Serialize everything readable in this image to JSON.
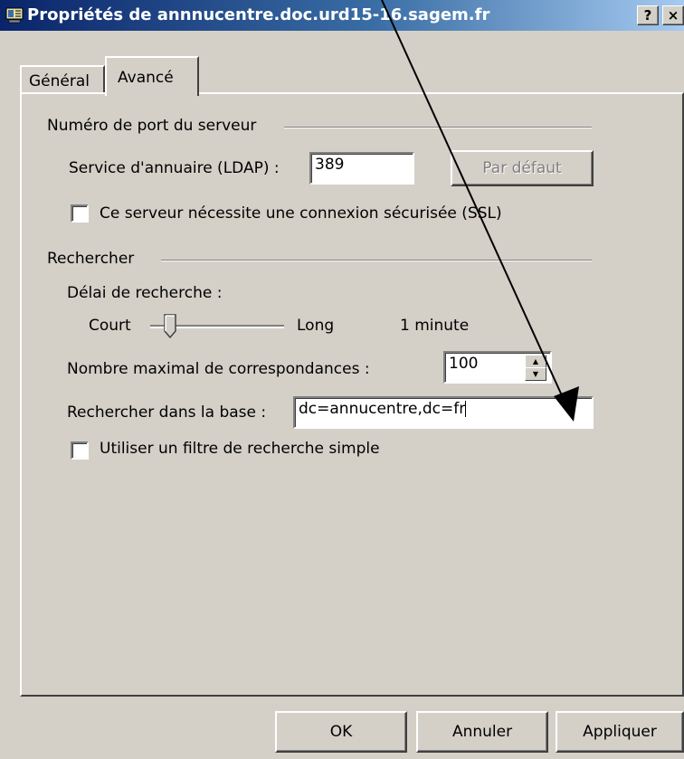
{
  "window": {
    "title": "Propriétés de annnucentre.doc.urd15-16.sagem.fr",
    "help_label": "?",
    "close_label": "×"
  },
  "tabs": [
    {
      "label": "Général",
      "active": false
    },
    {
      "label": "Avancé",
      "active": true
    }
  ],
  "port_group": {
    "title": "Numéro de port du serveur",
    "ldap_label": "Service d'annuaire (LDAP) :",
    "ldap_value": "389",
    "default_button": "Par défaut",
    "ssl_label": "Ce serveur nécessite une connexion sécurisée (SSL)",
    "ssl_checked": false
  },
  "search_group": {
    "title": "Rechercher",
    "timeout_label": "Délai de recherche :",
    "short_label": "Court",
    "long_label": "Long",
    "timeout_value": "1 minute",
    "max_label": "Nombre maximal de correspondances :",
    "max_value": "100",
    "base_label": "Rechercher dans la base :",
    "base_value": "dc=annucentre,dc=fr",
    "simple_filter_label": "Utiliser un filtre de recherche simple",
    "simple_filter_checked": false
  },
  "footer": {
    "ok": "OK",
    "cancel": "Annuler",
    "apply": "Appliquer"
  },
  "icons": {
    "title_icon": "address-book-server-icon",
    "annotation": "arrow-annotation"
  }
}
